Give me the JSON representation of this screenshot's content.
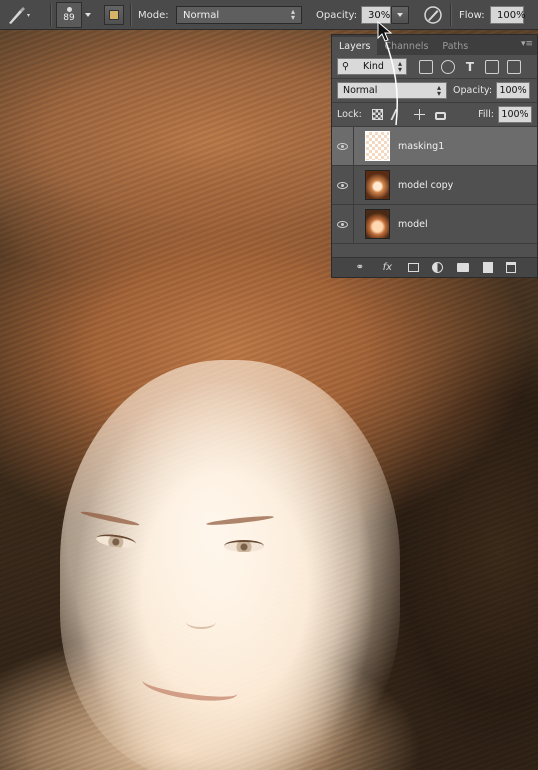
{
  "options_bar": {
    "brush_size": "89",
    "mode_label": "Mode:",
    "mode_value": "Normal",
    "opacity_label": "Opacity:",
    "opacity_value": "30%",
    "flow_label": "Flow:",
    "flow_value": "100%"
  },
  "layers_panel": {
    "tabs": [
      {
        "label": "Layers"
      },
      {
        "label": "Channels"
      },
      {
        "label": "Paths"
      }
    ],
    "filter_kind": "Kind",
    "blend_mode": "Normal",
    "opacity_label": "Opacity:",
    "opacity_value": "100%",
    "lock_label": "Lock:",
    "fill_label": "Fill:",
    "fill_value": "100%",
    "layers": [
      {
        "name": "masking1",
        "selected": true
      },
      {
        "name": "model copy",
        "selected": false
      },
      {
        "name": "model",
        "selected": false
      }
    ],
    "footer_fx": "fx"
  },
  "icons": {
    "tool": "brush-icon",
    "airbrush": "airbrush-icon",
    "visibility": "eye-icon"
  },
  "colors": {
    "panel_bg": "#505050",
    "selected_layer": "#6c6c6c",
    "options_bar_bg": "#4a4a4a"
  }
}
